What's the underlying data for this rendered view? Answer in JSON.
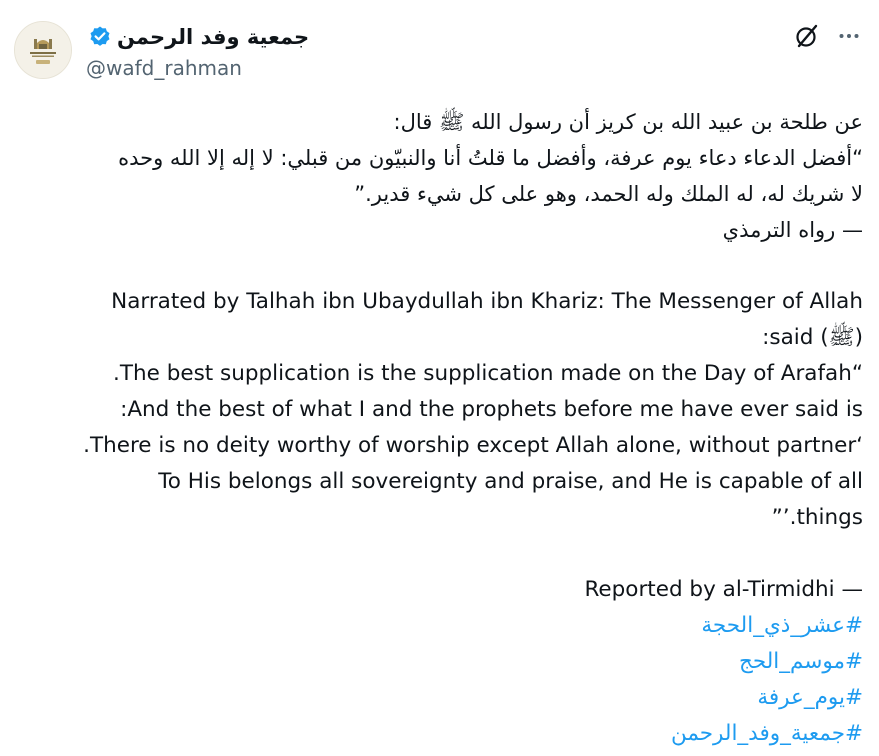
{
  "author": {
    "display_name": "جمعية وفد الرحمن",
    "handle": "@wafd_rahman",
    "verified": true,
    "avatar_icon": "association-logo-icon",
    "avatar_text": "جمعية وفد الرحمن"
  },
  "actions": {
    "grok_icon": "grok-icon",
    "more_icon": "more-icon"
  },
  "post": {
    "arabic_lines": [
      "عن طلحة بن عبيد الله بن كريز أن رسول الله ﷺ قال:",
      "“أفضل الدعاء دعاء يوم عرفة، وأفضل ما قلتُ أنا والنبيّون من قبلي: لا إله إلا الله وحده",
      "لا شريك له، له الملك وله الحمد، وهو على كل شيء قدير.”",
      "— رواه الترمذي"
    ],
    "english_lines": [
      "Narrated by Talhah ibn Ubaydullah ibn Khariz: The Messenger of Allah",
      "(ﷺ) said:",
      "“The best supplication is the supplication made on the Day of Arafah.",
      "And the best of what I and the prophets before me have ever said is:",
      "‘There is no deity worthy of worship except Allah alone, without partner.",
      "To His belongs all sovereignty and praise, and He is capable of all",
      "things.’”",
      "— Reported by al-Tirmidhi"
    ],
    "hashtags": [
      "#عشر_ذي_الحجة",
      "#موسم_الحج",
      "#يوم_عرفة",
      "#جمعية_وفد_الرحمن"
    ]
  },
  "colors": {
    "text": "#0f1419",
    "secondary": "#536471",
    "link": "#1d9bf0",
    "verified": "#1d9bf0"
  }
}
